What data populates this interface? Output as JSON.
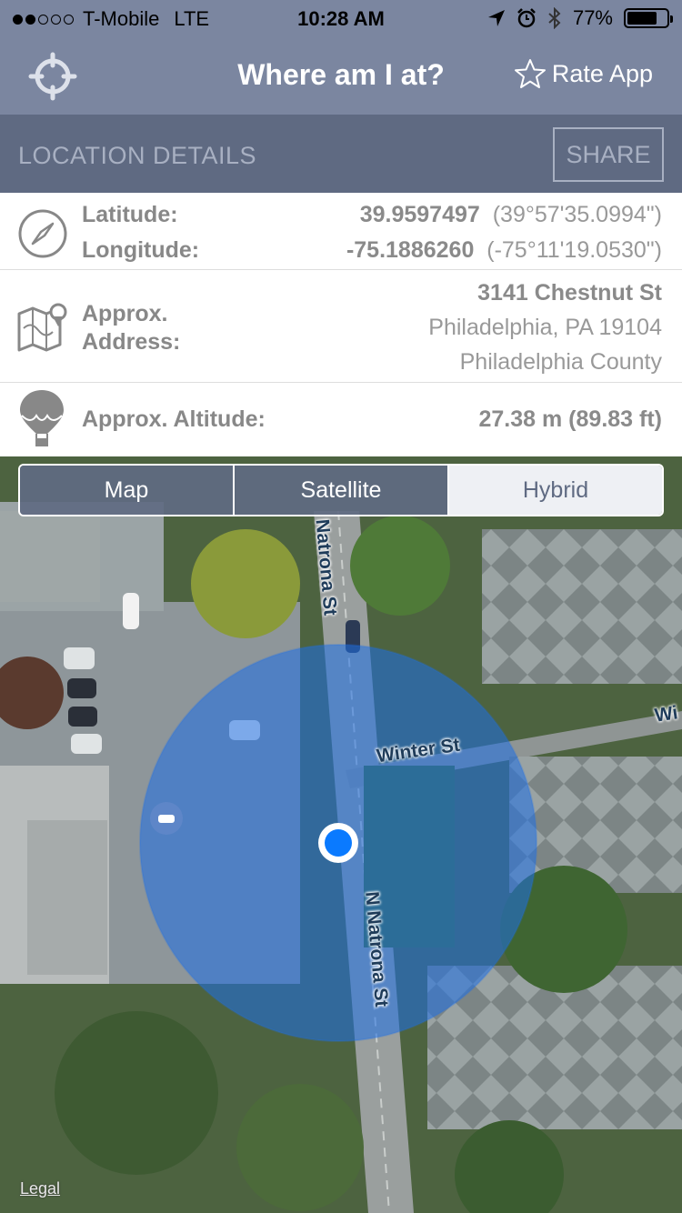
{
  "status_bar": {
    "carrier": "T-Mobile",
    "network": "LTE",
    "time": "10:28 AM",
    "battery": "77%",
    "battery_level": 0.77
  },
  "nav": {
    "title": "Where am I at?",
    "rate_label": "Rate App"
  },
  "section": {
    "title": "LOCATION DETAILS",
    "share_label": "SHARE"
  },
  "coordinates": {
    "lat_label": "Latitude:",
    "lat_value": "39.9597497",
    "lat_dms": "(39°57'35.0994\")",
    "lon_label": "Longitude:",
    "lon_value": "-75.1886260",
    "lon_dms": "(-75°11'19.0530\")"
  },
  "address": {
    "label_line1": "Approx.",
    "label_line2": "Address:",
    "street": "3141 Chestnut St",
    "city": "Philadelphia, PA 19104",
    "county": "Philadelphia County"
  },
  "altitude": {
    "label": "Approx. Altitude:",
    "value": "27.38 m (89.83 ft)"
  },
  "map": {
    "modes": [
      "Map",
      "Satellite",
      "Hybrid"
    ],
    "selected_mode": "Hybrid",
    "streets": {
      "natrona_top": "Natrona St",
      "winter": "Winter St",
      "natrona_bottom": "N Natrona St",
      "edge": "Wi"
    },
    "legal": "Legal"
  },
  "colors": {
    "bar": "#7b86a0",
    "section": "#5f6a82",
    "location_dot": "#0a7aff"
  }
}
